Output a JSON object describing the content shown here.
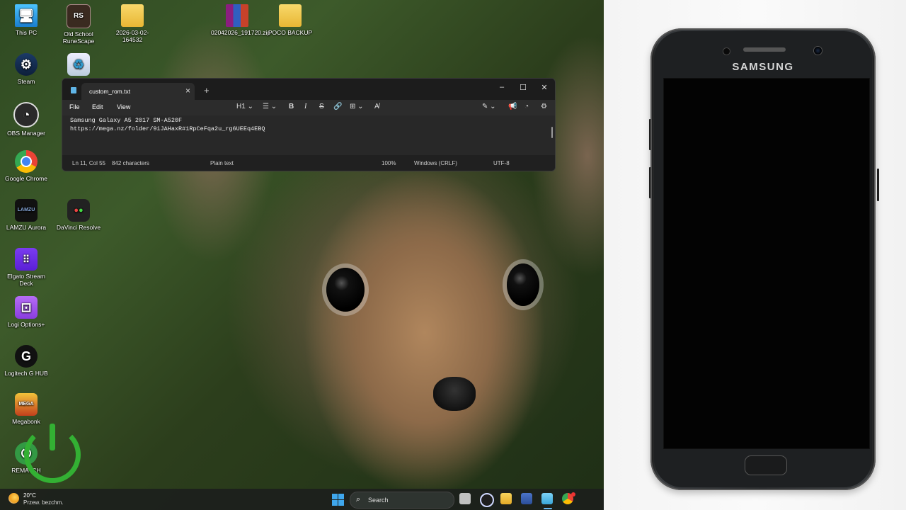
{
  "desktop": {
    "icons": [
      {
        "label": "This PC"
      },
      {
        "label": "Old School RuneScape"
      },
      {
        "label": "2026-03-02-164532"
      },
      {
        "label": "02042026_191720.zip"
      },
      {
        "label": "POCO BACKUP"
      },
      {
        "label": "Steam"
      },
      {
        "label": "OBS Manager"
      },
      {
        "label": "Google Chrome"
      },
      {
        "label": "LAMZU Aurora"
      },
      {
        "label": "DaVinci Resolve"
      },
      {
        "label": "Elgato Stream Deck"
      },
      {
        "label": "Logi Options+"
      },
      {
        "label": "Logitech G HUB"
      },
      {
        "label": "Megabonk"
      },
      {
        "label": "REMATCH"
      }
    ]
  },
  "notepad": {
    "tab_title": "custom_rom.txt",
    "menu": {
      "file": "File",
      "edit": "Edit",
      "view": "View"
    },
    "toolbar": {
      "heading": "H1"
    },
    "content": [
      "Samsung Galaxy A5 2017 SM-A520F",
      "https://mega.nz/folder/9iJAHaxR#1RpCeFqa2u_rg6UEEq4EBQ"
    ],
    "status": {
      "position": "Ln 11, Col 55",
      "characters": "842 characters",
      "format": "Plain text",
      "zoom": "100%",
      "line_ending": "Windows (CRLF)",
      "encoding": "UTF-8"
    }
  },
  "taskbar": {
    "weather_temp": "20°C",
    "weather_desc": "Przew. bezchm.",
    "search_placeholder": "Search"
  },
  "phone": {
    "brand": "SAMSUNG"
  }
}
